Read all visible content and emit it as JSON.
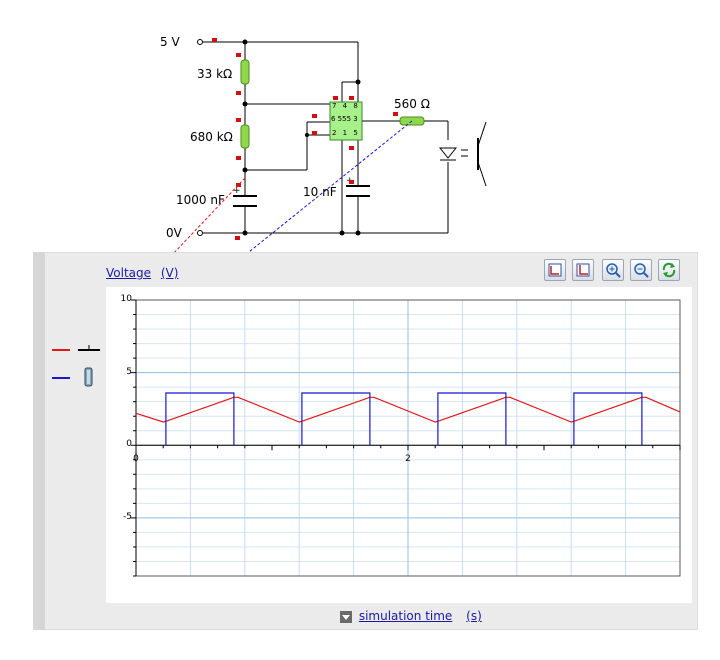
{
  "circuit": {
    "supply_label": "5 V",
    "ground_label": "0V",
    "r1_label": "33 kΩ",
    "r2_label": "680 kΩ",
    "c1_label": "1000 nF",
    "c2_label": "10 nF",
    "r3_label": "560 Ω",
    "ic": {
      "top_pins": "7 4 8",
      "mid_pins": "6 555 3",
      "bottom_pins": "2 1 5"
    }
  },
  "plot": {
    "y_quantity_link": "Voltage",
    "y_unit_link": "(V)",
    "x_quantity_link": "simulation time",
    "x_unit_link": "(s)",
    "tools": [
      {
        "name": "fit-axes-icon"
      },
      {
        "name": "reset-axes-icon"
      },
      {
        "name": "zoom-in-icon"
      },
      {
        "name": "zoom-out-icon"
      },
      {
        "name": "refresh-icon"
      }
    ],
    "legend": [
      {
        "color": "#e01818",
        "probe": "voltmeter-probe-icon"
      },
      {
        "color": "#1818d0",
        "probe": "led-probe-icon"
      }
    ]
  },
  "chart_data": {
    "type": "line",
    "xlim": [
      0,
      4
    ],
    "ylim": [
      -9,
      10
    ],
    "x_ticks": [
      "0",
      "2"
    ],
    "y_ticks": [
      "10",
      "5",
      "0",
      "-5"
    ],
    "grid": true,
    "series": [
      {
        "color": "#e01818",
        "x": [
          0.0,
          0.2,
          0.22,
          0.72,
          0.75,
          1.2,
          1.22,
          1.72,
          1.75,
          2.2,
          2.22,
          2.72,
          2.75,
          3.2,
          3.22,
          3.72,
          3.75,
          4.0
        ],
        "y": [
          2.2,
          1.6,
          1.65,
          3.3,
          3.3,
          1.6,
          1.65,
          3.3,
          3.3,
          1.6,
          1.65,
          3.3,
          3.3,
          1.6,
          1.65,
          3.3,
          3.3,
          2.3
        ]
      },
      {
        "color": "#1818d0",
        "x": [
          0.22,
          0.22,
          0.72,
          0.72,
          1.22,
          1.22,
          1.72,
          1.72,
          2.22,
          2.22,
          2.72,
          2.72,
          3.22,
          3.22,
          3.72,
          3.72
        ],
        "y": [
          0,
          3.6,
          3.6,
          0,
          0,
          3.6,
          3.6,
          0,
          0,
          3.6,
          3.6,
          0,
          0,
          3.6,
          3.6,
          0
        ],
        "segments": [
          [
            0,
            1,
            2,
            3
          ],
          [
            4,
            5,
            6,
            7
          ],
          [
            8,
            9,
            10,
            11
          ],
          [
            12,
            13,
            14,
            15
          ]
        ]
      }
    ]
  }
}
